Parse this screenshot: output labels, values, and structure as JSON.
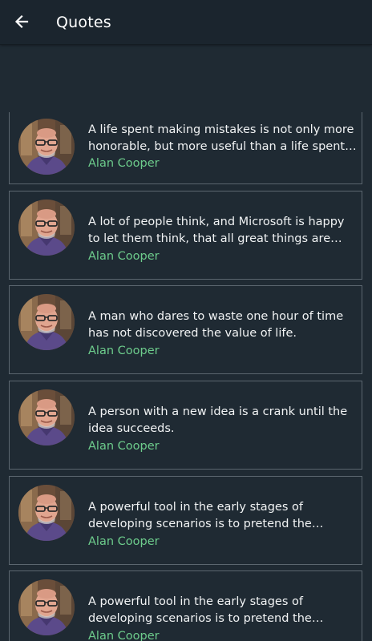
{
  "appbar": {
    "back_icon": "arrow-back-icon",
    "title": "Quotes"
  },
  "colors": {
    "background": "#1f2a33",
    "appbar": "#1b252e",
    "card_border": "#5b666f",
    "quote_text": "#f1f3f4",
    "author_text": "#6dcc8c"
  },
  "quotes": [
    {
      "text": "A life spent making mistakes is not only more honorable, but more useful than a life spent doing nothing.",
      "author": "Alan Cooper",
      "avatar_icon": "author-avatar"
    },
    {
      "text": "A lot of people think, and Microsoft is happy to let them think, that all great things are invented by Microsoft.",
      "author": "Alan Cooper",
      "avatar_icon": "author-avatar"
    },
    {
      "text": "A man who dares to waste one hour of time has not discovered the value of life.",
      "author": "Alan Cooper",
      "avatar_icon": "author-avatar"
    },
    {
      "text": "A person with a new idea is a crank until the idea succeeds.",
      "author": "Alan Cooper",
      "avatar_icon": "author-avatar"
    },
    {
      "text": "A powerful tool in the early stages of developing scenarios is to pretend the interface is magic.",
      "author": "Alan Cooper",
      "avatar_icon": "author-avatar"
    },
    {
      "text": "A powerful tool in the early stages of developing scenarios is to pretend the interface is magic. If...",
      "author": "Alan Cooper",
      "avatar_icon": "author-avatar"
    }
  ]
}
